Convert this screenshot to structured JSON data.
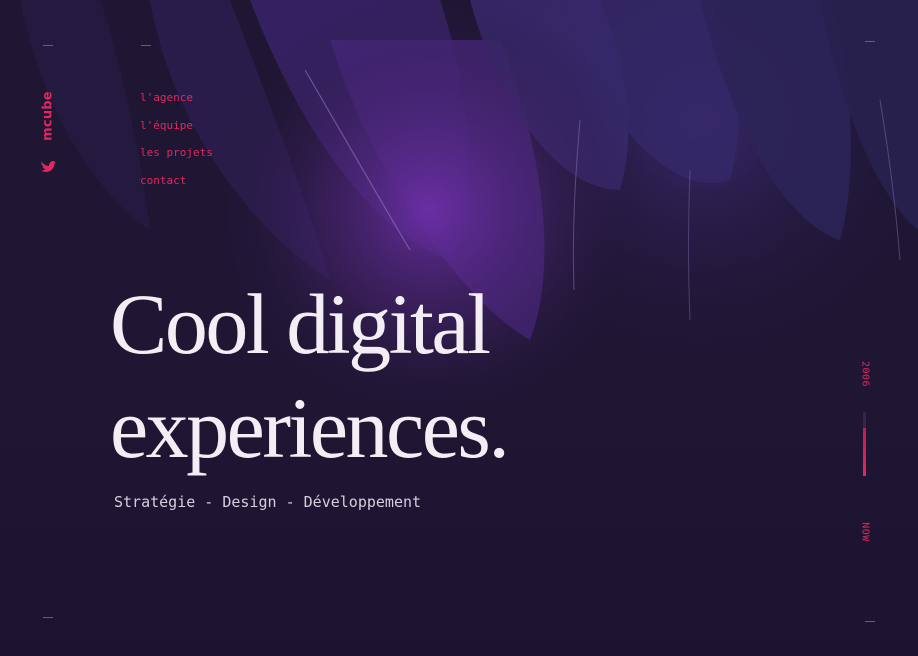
{
  "brand": {
    "logo_text": "mcube",
    "accent_color": "#e0285e"
  },
  "social": {
    "icon": "twitter-bird-icon"
  },
  "nav": {
    "items": [
      {
        "label": "l'agence"
      },
      {
        "label": "l'équipe"
      },
      {
        "label": "les projets"
      },
      {
        "label": "contact"
      }
    ]
  },
  "hero": {
    "headline_line1": "Cool digital",
    "headline_line2": "experiences.",
    "tagline": "Stratégie - Design - Développement"
  },
  "timeline": {
    "start_label": "2006",
    "end_label": "NOW",
    "progress": 0.75
  },
  "colors": {
    "background": "#1d1430",
    "text": "#f3eef4",
    "tagline": "#d7cfdd"
  }
}
